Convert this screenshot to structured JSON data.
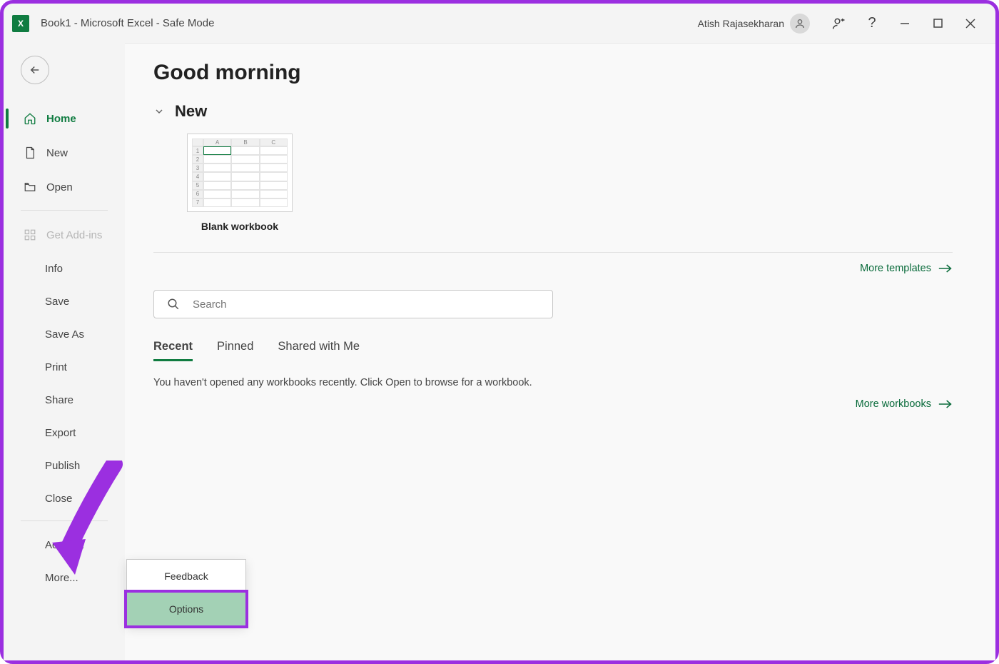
{
  "window": {
    "title": "Book1  -  Microsoft Excel  -  Safe Mode",
    "user": "Atish Rajasekharan"
  },
  "sidebar": {
    "items": [
      {
        "label": "Home",
        "icon": "home",
        "active": true
      },
      {
        "label": "New",
        "icon": "page"
      },
      {
        "label": "Open",
        "icon": "folder"
      }
    ],
    "addins_label": "Get Add-ins",
    "secondary": [
      {
        "label": "Info"
      },
      {
        "label": "Save"
      },
      {
        "label": "Save As"
      },
      {
        "label": "Print"
      },
      {
        "label": "Share"
      },
      {
        "label": "Export"
      },
      {
        "label": "Publish"
      },
      {
        "label": "Close"
      }
    ],
    "footer": [
      {
        "label": "Account"
      },
      {
        "label": "More..."
      }
    ]
  },
  "main": {
    "greeting": "Good morning",
    "new_section": "New",
    "template_label": "Blank workbook",
    "more_templates": "More templates",
    "search_placeholder": "Search",
    "tabs": [
      {
        "label": "Recent",
        "active": true
      },
      {
        "label": "Pinned"
      },
      {
        "label": "Shared with Me"
      }
    ],
    "empty_message": "You haven't opened any workbooks recently. Click Open to browse for a workbook.",
    "more_workbooks": "More workbooks"
  },
  "popup": {
    "items": [
      {
        "label": "Feedback"
      },
      {
        "label": "Options",
        "highlight": true
      }
    ]
  }
}
